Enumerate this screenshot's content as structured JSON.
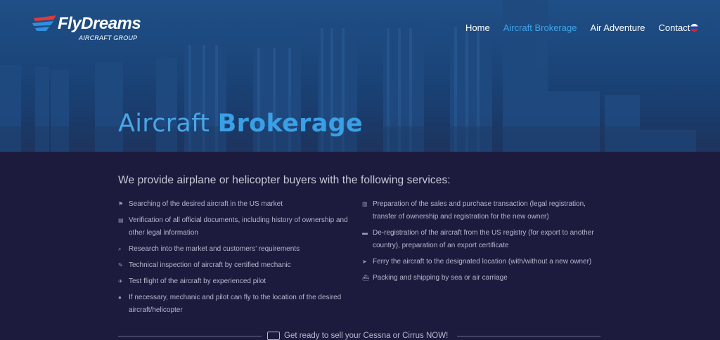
{
  "brand": {
    "name": "FlyDreams",
    "tagline": "AIRCRAFT GROUP"
  },
  "nav": {
    "items": [
      {
        "label": "Home",
        "active": false
      },
      {
        "label": "Aircraft Brokerage",
        "active": true
      },
      {
        "label": "Air Adventure",
        "active": false
      },
      {
        "label": "Contact",
        "active": false
      }
    ],
    "language_icon": "russia-flag-icon"
  },
  "hero": {
    "title_part1": "Aircraft ",
    "title_part2": "Brokerage"
  },
  "intro": "We provide airplane or helicopter buyers with the following services:",
  "services_left": [
    {
      "icon": "flag-icon",
      "glyph": "⚑",
      "text": "Searching of the desired aircraft in the US market"
    },
    {
      "icon": "document-icon",
      "glyph": "▤",
      "text": "Verification of all official documents, including history of ownership and other legal information"
    },
    {
      "icon": "search-icon",
      "glyph": "⌕",
      "text": "Research into the market and customers’ requirements"
    },
    {
      "icon": "wrench-icon",
      "glyph": "✎",
      "text": "Technical inspection of aircraft by certified mechanic"
    },
    {
      "icon": "plane-icon",
      "glyph": "✈",
      "text": "Test flight of the aircraft by experienced pilot"
    },
    {
      "icon": "map-marker-icon",
      "glyph": "●",
      "text": "If necessary, mechanic and pilot can fly to the location of the desired aircraft/helicopter"
    }
  ],
  "services_right": [
    {
      "icon": "copy-document-icon",
      "glyph": "▥",
      "text": "Preparation of the sales and purchase transaction (legal registration, transfer of ownership and registration for the new owner)"
    },
    {
      "icon": "folder-icon",
      "glyph": "▬",
      "text": "De-registration of the aircraft from the US registry (for export to another country), preparation of an export certificate"
    },
    {
      "icon": "location-arrow-icon",
      "glyph": "➤",
      "text": "Ferry the aircraft to the designated location (with/without a new owner)"
    },
    {
      "icon": "ship-icon",
      "glyph": "⛴",
      "text": "Packing and shipping by sea or air carriage"
    }
  ],
  "cta": {
    "text": "Get ready to sell your Cessna or Cirrus NOW!",
    "icon": "handshake-icon"
  },
  "colors": {
    "accent": "#3ea6e8",
    "background": "#1c1b3e",
    "hero": "#1b467b"
  }
}
